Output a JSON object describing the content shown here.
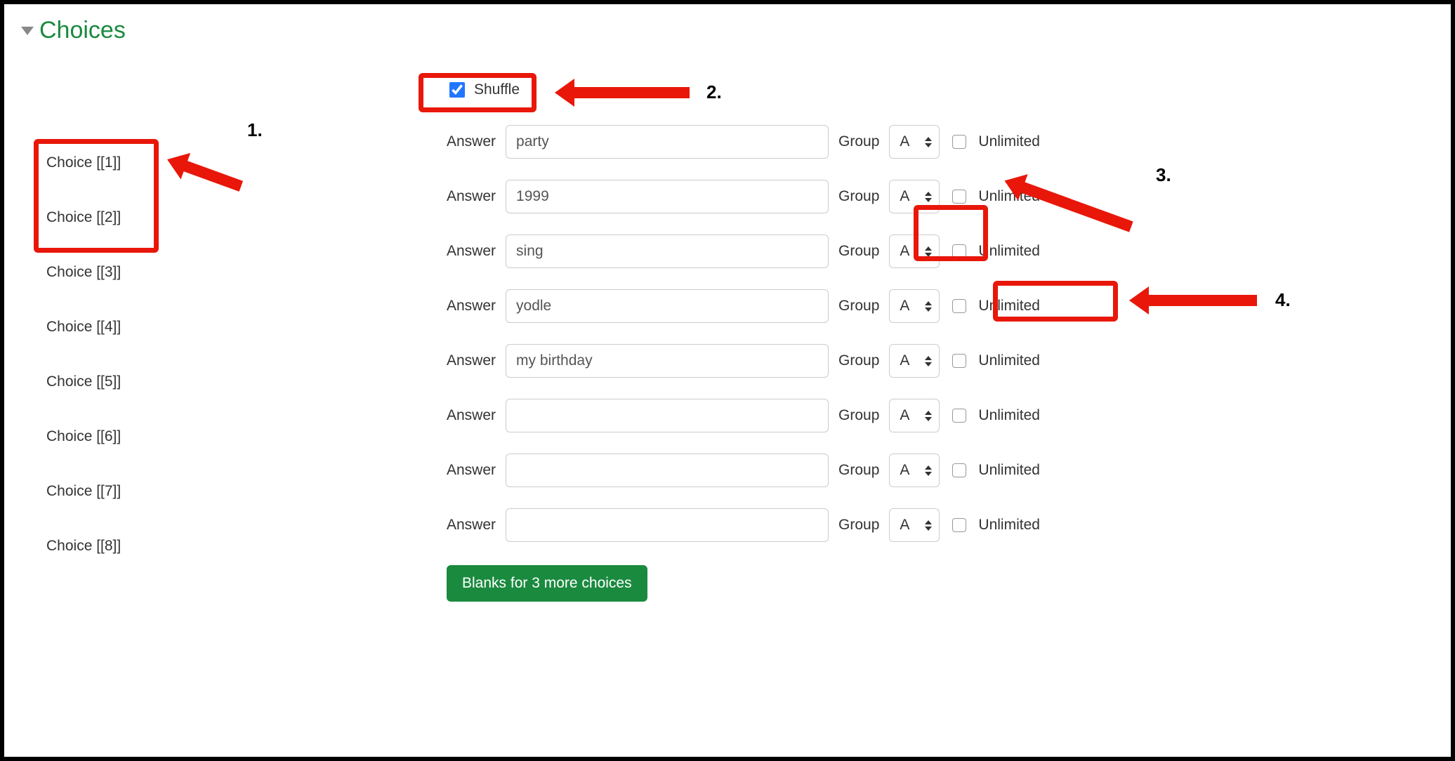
{
  "section": {
    "title": "Choices"
  },
  "shuffle": {
    "label": "Shuffle",
    "checked": true
  },
  "labels": {
    "answer": "Answer",
    "group": "Group",
    "unlimited": "Unlimited"
  },
  "choices": [
    {
      "label": "Choice [[1]]",
      "answer": "party",
      "group": "A",
      "unlimited": false
    },
    {
      "label": "Choice [[2]]",
      "answer": "1999",
      "group": "A",
      "unlimited": false
    },
    {
      "label": "Choice [[3]]",
      "answer": "sing",
      "group": "A",
      "unlimited": false
    },
    {
      "label": "Choice [[4]]",
      "answer": "yodle",
      "group": "A",
      "unlimited": false
    },
    {
      "label": "Choice [[5]]",
      "answer": "my birthday",
      "group": "A",
      "unlimited": false
    },
    {
      "label": "Choice [[6]]",
      "answer": "",
      "group": "A",
      "unlimited": false
    },
    {
      "label": "Choice [[7]]",
      "answer": "",
      "group": "A",
      "unlimited": false
    },
    {
      "label": "Choice [[8]]",
      "answer": "",
      "group": "A",
      "unlimited": false
    }
  ],
  "addButton": {
    "label": "Blanks for 3 more choices"
  },
  "annotations": {
    "1": "1.",
    "2": "2.",
    "3": "3.",
    "4": "4."
  }
}
